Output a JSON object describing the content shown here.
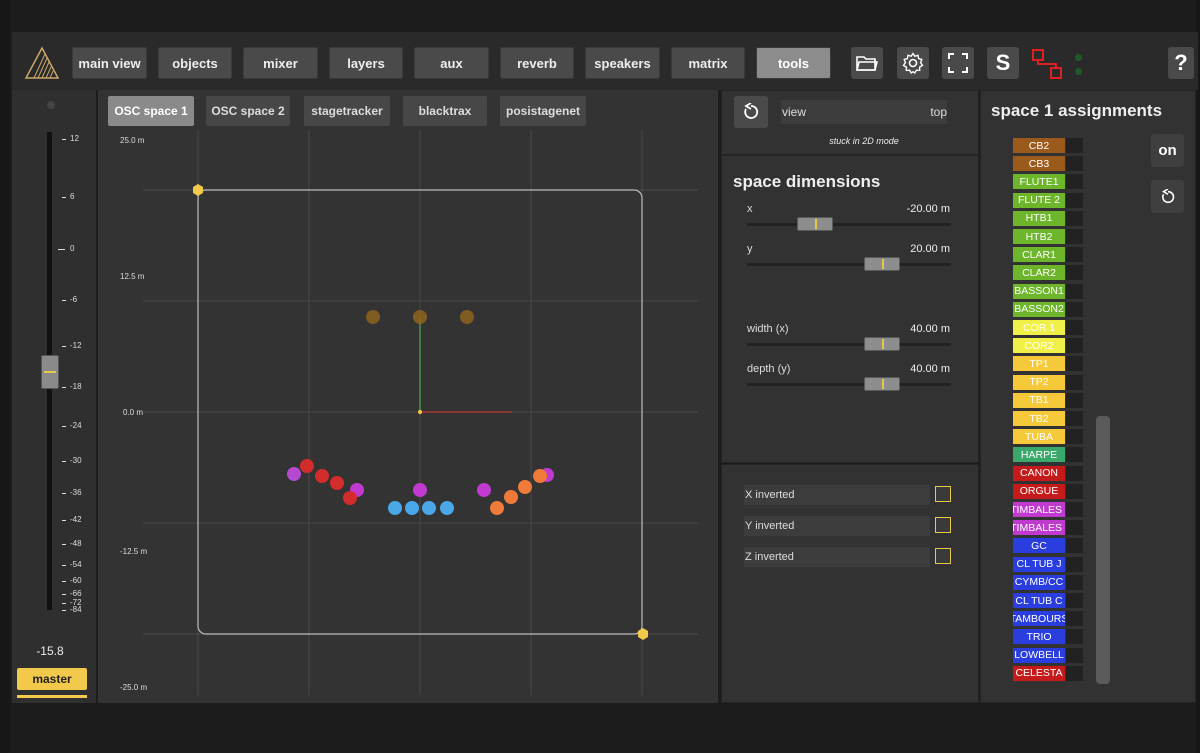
{
  "nav": {
    "tabs": [
      {
        "label": "main view",
        "active": false
      },
      {
        "label": "objects",
        "active": false
      },
      {
        "label": "mixer",
        "active": false
      },
      {
        "label": "layers",
        "active": false
      },
      {
        "label": "aux",
        "active": false
      },
      {
        "label": "reverb",
        "active": false
      },
      {
        "label": "speakers",
        "active": false
      },
      {
        "label": "matrix",
        "active": false
      },
      {
        "label": "tools",
        "active": true
      }
    ],
    "solo_label": "S",
    "help_label": "?",
    "icons": [
      "folder-icon",
      "gear-icon",
      "fullscreen-icon",
      "solo-button",
      "network-icon",
      "help-icon"
    ]
  },
  "fader": {
    "scale": [
      "12",
      "6",
      "0",
      "-6",
      "-12",
      "-18",
      "-24",
      "-30",
      "-36",
      "-42",
      "-48",
      "-54",
      "-60",
      "-66",
      "-72",
      "-84"
    ],
    "value": "-15.8",
    "value_level_db": -15.8,
    "label": "master"
  },
  "space_tabs": [
    {
      "label": "OSC space 1",
      "active": true
    },
    {
      "label": "OSC space 2",
      "active": false
    },
    {
      "label": "stagetracker",
      "active": false
    },
    {
      "label": "blacktrax",
      "active": false
    },
    {
      "label": "posistagenet",
      "active": false
    }
  ],
  "grid": {
    "y_labels": [
      "25.0 m",
      "12.5 m",
      "0.0 m",
      "-12.5 m",
      "-25.0 m"
    ]
  },
  "view": {
    "reset_icon": "reset-icon",
    "view_label": "view",
    "view_value": "top",
    "note": "stuck in 2D mode"
  },
  "dimensions": {
    "title": "space dimensions",
    "fields": [
      {
        "label": "x",
        "value": "-20.00 m"
      },
      {
        "label": "y",
        "value": "20.00 m"
      },
      {
        "label": "width (x)",
        "value": "40.00 m"
      },
      {
        "label": "depth (y)",
        "value": "40.00 m"
      }
    ]
  },
  "inversions": [
    {
      "label": "X inverted",
      "checked": false
    },
    {
      "label": "Y inverted",
      "checked": false
    },
    {
      "label": "Z inverted",
      "checked": false
    }
  ],
  "assignments": {
    "title": "space 1 assignments",
    "on_label": "on",
    "items": [
      {
        "label": "CB2",
        "color": "#9a5a1c"
      },
      {
        "label": "CB3",
        "color": "#9a5a1c"
      },
      {
        "label": "FLUTE1",
        "color": "#6db52b"
      },
      {
        "label": "FLUTE 2",
        "color": "#6db52b"
      },
      {
        "label": "HTB1",
        "color": "#6db52b"
      },
      {
        "label": "HTB2",
        "color": "#6db52b"
      },
      {
        "label": "CLAR1",
        "color": "#6db52b"
      },
      {
        "label": "CLAR2",
        "color": "#6db52b"
      },
      {
        "label": "BASSON1",
        "color": "#6db52b"
      },
      {
        "label": "BASSON2",
        "color": "#6db52b"
      },
      {
        "label": "COR 1",
        "color": "#f0f048"
      },
      {
        "label": "COR2",
        "color": "#f0f048"
      },
      {
        "label": "TP1",
        "color": "#f5c93a"
      },
      {
        "label": "TP2",
        "color": "#f5c93a"
      },
      {
        "label": "TB1",
        "color": "#f5c93a"
      },
      {
        "label": "TB2",
        "color": "#f5c93a"
      },
      {
        "label": "TUBA",
        "color": "#f5c93a"
      },
      {
        "label": "HARPE",
        "color": "#3aa86a"
      },
      {
        "label": "CANON",
        "color": "#c41a1a"
      },
      {
        "label": "ORGUE",
        "color": "#c41a1a"
      },
      {
        "label": "TIMBALES I",
        "color": "#c03ad0"
      },
      {
        "label": "TIMBALES I",
        "color": "#c03ad0"
      },
      {
        "label": "GC",
        "color": "#2a3ee0"
      },
      {
        "label": "CL TUB J",
        "color": "#2a3ee0"
      },
      {
        "label": "CYMB/CC",
        "color": "#2a3ee0"
      },
      {
        "label": "CL TUB C",
        "color": "#2a3ee0"
      },
      {
        "label": "TAMBOURS",
        "color": "#2a3ee0"
      },
      {
        "label": "TRIO",
        "color": "#2a3ee0"
      },
      {
        "label": "LOWBELL",
        "color": "#2a3ee0"
      },
      {
        "label": "CELESTA",
        "color": "#c41a1a"
      }
    ]
  }
}
